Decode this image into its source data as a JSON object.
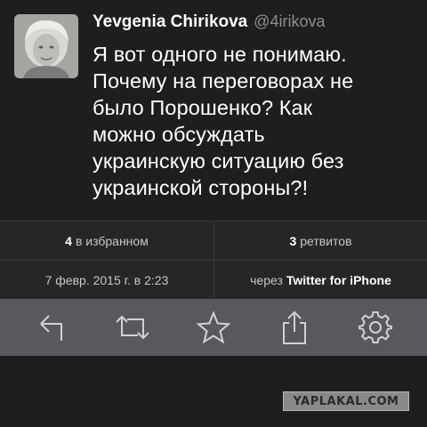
{
  "tweet": {
    "display_name": "Yevgenia Chirikova",
    "handle": "@4irikova",
    "text_lines": [
      "Я вот одного не понимаю.",
      "Почему на переговорах не",
      "было Порошенко? Как",
      "можно обсуждать",
      "украинскую ситуацию без",
      "украинской стороны?!"
    ]
  },
  "stats": {
    "favorites_count": "4",
    "favorites_label": "в избранном",
    "retweets_count": "3",
    "retweets_label": "ретвитов",
    "date": "7 февр. 2015 г. в 2:23",
    "via_prefix": "через",
    "via_client": "Twitter for iPhone"
  },
  "toolbar": {
    "icons": [
      "reply-icon",
      "retweet-icon",
      "favorite-star-icon",
      "share-icon",
      "settings-gear-icon"
    ]
  },
  "watermark": {
    "text": "YAPLAKAL.COM"
  },
  "colors": {
    "background": "#1e1e20",
    "stats_background": "#262628",
    "toolbar_background": "#58585e",
    "handle_gray": "#8e8e93"
  }
}
